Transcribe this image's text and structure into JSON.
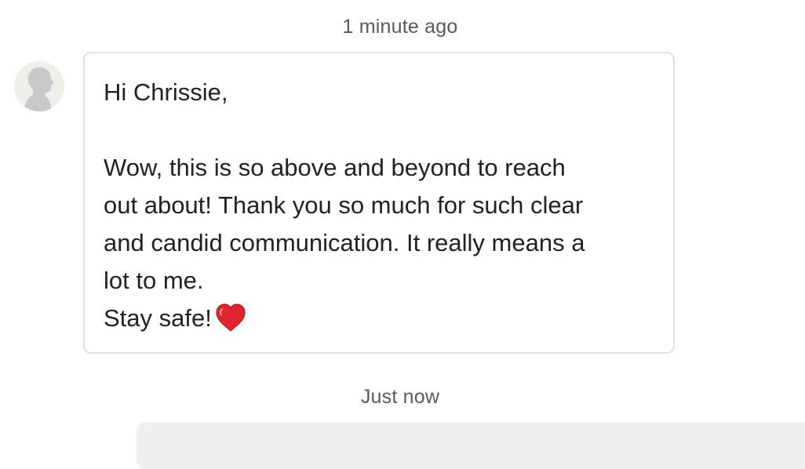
{
  "conversation": {
    "timestamp_top": "1 minute ago",
    "timestamp_bottom": "Just now",
    "incoming_message": {
      "avatar_icon": "person-silhouette-icon",
      "lines": {
        "greeting": "Hi Chrissie,",
        "line1": "Wow, this is so above and beyond to reach",
        "line2": "out about! Thank you so much for such clear",
        "line3": "and candid communication. It really means a",
        "line4": "lot to me.",
        "line5": "Stay safe!"
      },
      "emoji_icon": "red-heart-icon",
      "border_color": "#e1e1e1"
    },
    "outgoing_bubble_color": "#efefef"
  }
}
